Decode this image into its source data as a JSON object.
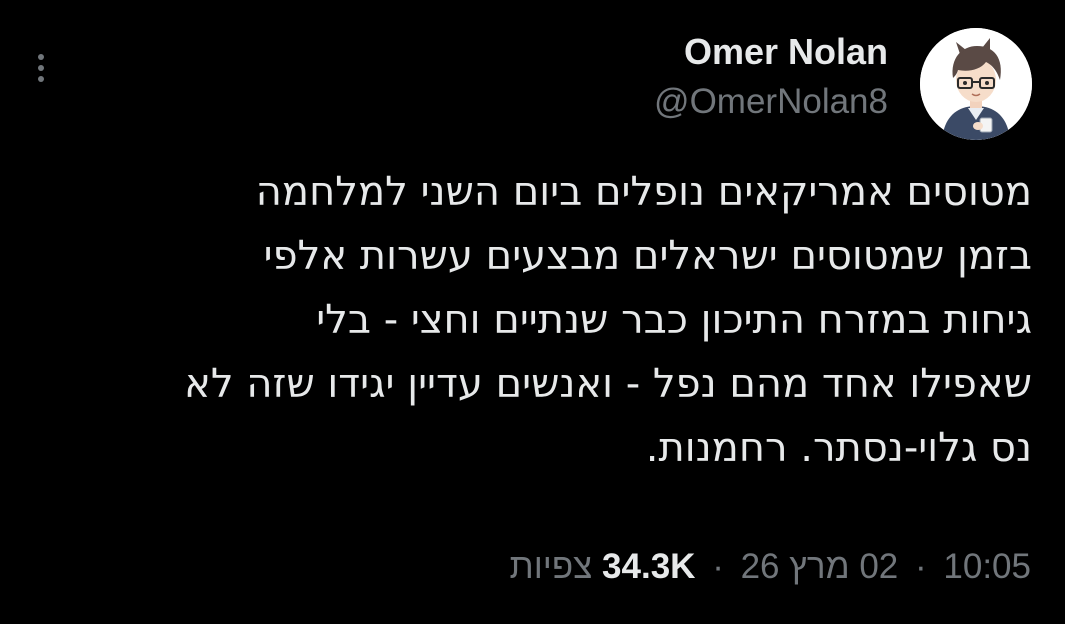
{
  "author": {
    "display_name": "Omer Nolan",
    "handle": "@OmerNolan8",
    "avatar_icon": "user-avatar-illustration"
  },
  "tweet": {
    "lines": [
      "מטוסים אמריקאים נופלים ביום השני למלחמה",
      "בזמן שמטוסים ישראלים מבצעים עשרות אלפי",
      "גיחות במזרח התיכון כבר שנתיים וחצי - בלי",
      "שאפילו אחד מהם נפל - ואנשים עדיין יגידו שזה לא",
      "נס גלוי-נסתר. רחמנות."
    ]
  },
  "meta": {
    "time": "10:05",
    "separator": "·",
    "date": "02 מרץ 26",
    "views_count": "34.3K",
    "views_label": "צפיות"
  },
  "icons": {
    "more": "more-vertical-icon"
  },
  "colors": {
    "background": "#000000",
    "primary_text": "#e7e9ea",
    "secondary_text": "#71767b"
  }
}
